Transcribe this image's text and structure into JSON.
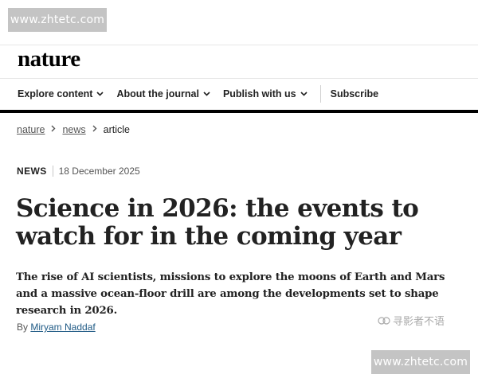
{
  "watermark": {
    "top": "www.zhtetc.com",
    "bottom": "www.zhtetc.com"
  },
  "logo": "nature",
  "nav": {
    "items": [
      "Explore content",
      "About the journal",
      "Publish with us"
    ],
    "subscribe": "Subscribe"
  },
  "breadcrumb": {
    "home": "nature",
    "section": "news",
    "current": "article"
  },
  "article": {
    "type": "NEWS",
    "date": "18 December 2025",
    "title": "Science in 2026: the events to watch for in the coming year",
    "standfirst": "The rise of AI scientists, missions to explore the moons of Earth and Mars and a massive ocean-floor drill are among the developments set to shape research in 2026.",
    "byline_prefix": "By",
    "author": "Miryam Naddaf"
  },
  "corner_watermark": "寻影者不语",
  "colors": {
    "accent_bar": "#000000",
    "author_link": "#1f5a85",
    "watermark_bg": "#c4c4c4"
  }
}
